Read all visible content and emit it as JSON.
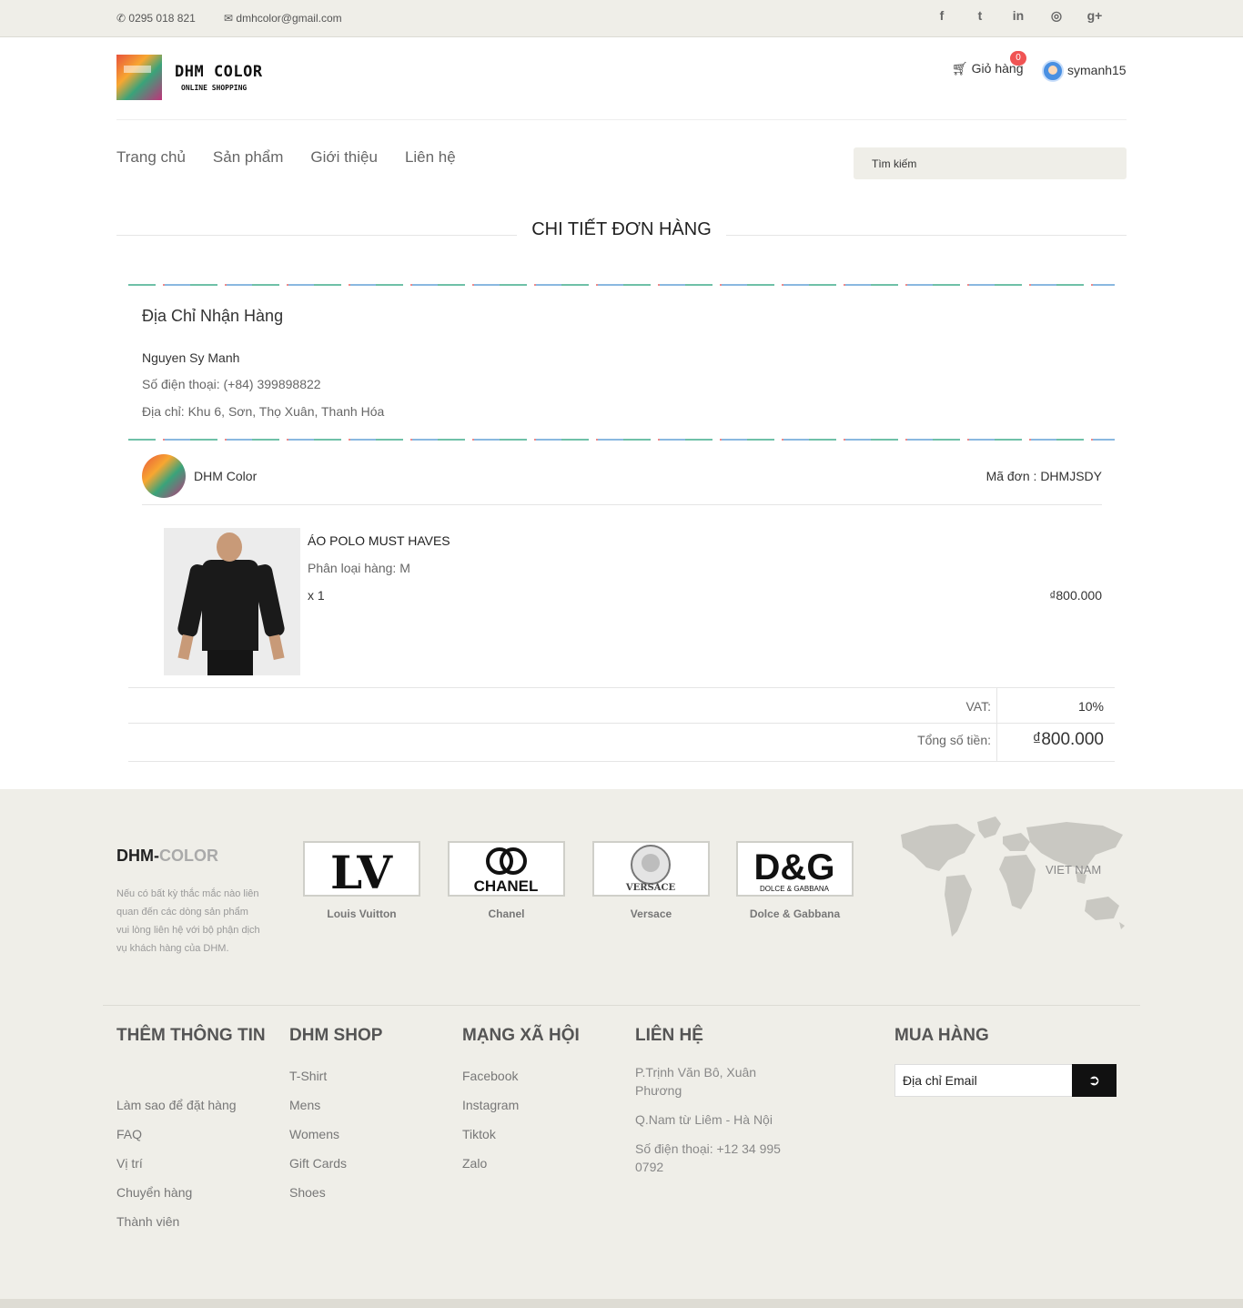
{
  "topbar": {
    "phone": "0295 018 821",
    "email": "dmhcolor@gmail.com",
    "social": [
      "f",
      "t",
      "in",
      "◎",
      "g+"
    ],
    "social_icons": [
      "facebook-icon",
      "twitter-icon",
      "linkedin-icon",
      "dribbble-icon",
      "google-plus-icon"
    ]
  },
  "header": {
    "logo_title": "DHM COLOR",
    "logo_sub": "ONLINE SHOPPING",
    "cart_label": "Giỏ hàng",
    "cart_count": "0",
    "username": "symanh15"
  },
  "nav": {
    "items": [
      "Trang chủ",
      "Sản phẩm",
      "Giới thiệu",
      "Liên hệ"
    ],
    "search_placeholder": "Tìm kiếm"
  },
  "page_title": "CHI TIẾT ĐƠN HÀNG",
  "address": {
    "title": "Địa Chỉ Nhận Hàng",
    "name": "Nguyen Sy Manh",
    "phone": "Số điện thoại: (+84) 399898822",
    "location": "Địa chỉ: Khu 6, Sơn, Thọ Xuân, Thanh Hóa"
  },
  "order": {
    "shop_name": "DHM Color",
    "order_code": "Mã đơn : DHMJSDY",
    "product": {
      "name": "ÁO POLO MUST HAVES",
      "variant": "Phân loại hàng: M",
      "qty": "x 1",
      "price": "₫800.000"
    },
    "vat_label": "VAT:",
    "vat_value": "10%",
    "total_label": "Tổng số tiền:",
    "total_value": "₫800.000"
  },
  "footer": {
    "brand_main": "DHM-",
    "brand_accent": "COLOR",
    "description": "Nếu có bất kỳ thắc mắc nào liên quan đến các dòng sản phẩm vui lòng liên hệ với bộ phận dịch vụ khách hàng của DHM.",
    "brands": [
      {
        "logo": "LV",
        "name": "Louis Vuitton"
      },
      {
        "logo": "CHANEL",
        "name": "Chanel"
      },
      {
        "logo": "VERSACE",
        "name": "Versace"
      },
      {
        "logo": "D&G",
        "logo_sub": "DOLCE & GABBANA",
        "name": "Dolce & Gabbana"
      }
    ],
    "map_label": "VIET NAM",
    "columns": {
      "info": {
        "title": "THÊM THÔNG TIN",
        "links": [
          "Làm sao để đặt hàng",
          "FAQ",
          "Vị trí",
          "Chuyển hàng",
          "Thành viên"
        ]
      },
      "shop": {
        "title": "DHM SHOP",
        "links": [
          "T-Shirt",
          "Mens",
          "Womens",
          "Gift Cards",
          "Shoes"
        ]
      },
      "social": {
        "title": "MẠNG XÃ HỘI",
        "links": [
          "Facebook",
          "Instagram",
          "Tiktok",
          "Zalo"
        ]
      },
      "contact": {
        "title": "LIÊN HỆ",
        "lines": [
          "P.Trịnh Văn Bô, Xuân Phương",
          "Q.Nam từ Liêm - Hà Nội",
          "Số điện thoại: +12 34 995 0792"
        ]
      },
      "buy": {
        "title": "MUA HÀNG",
        "email_placeholder": "Địa chỉ Email"
      }
    }
  }
}
